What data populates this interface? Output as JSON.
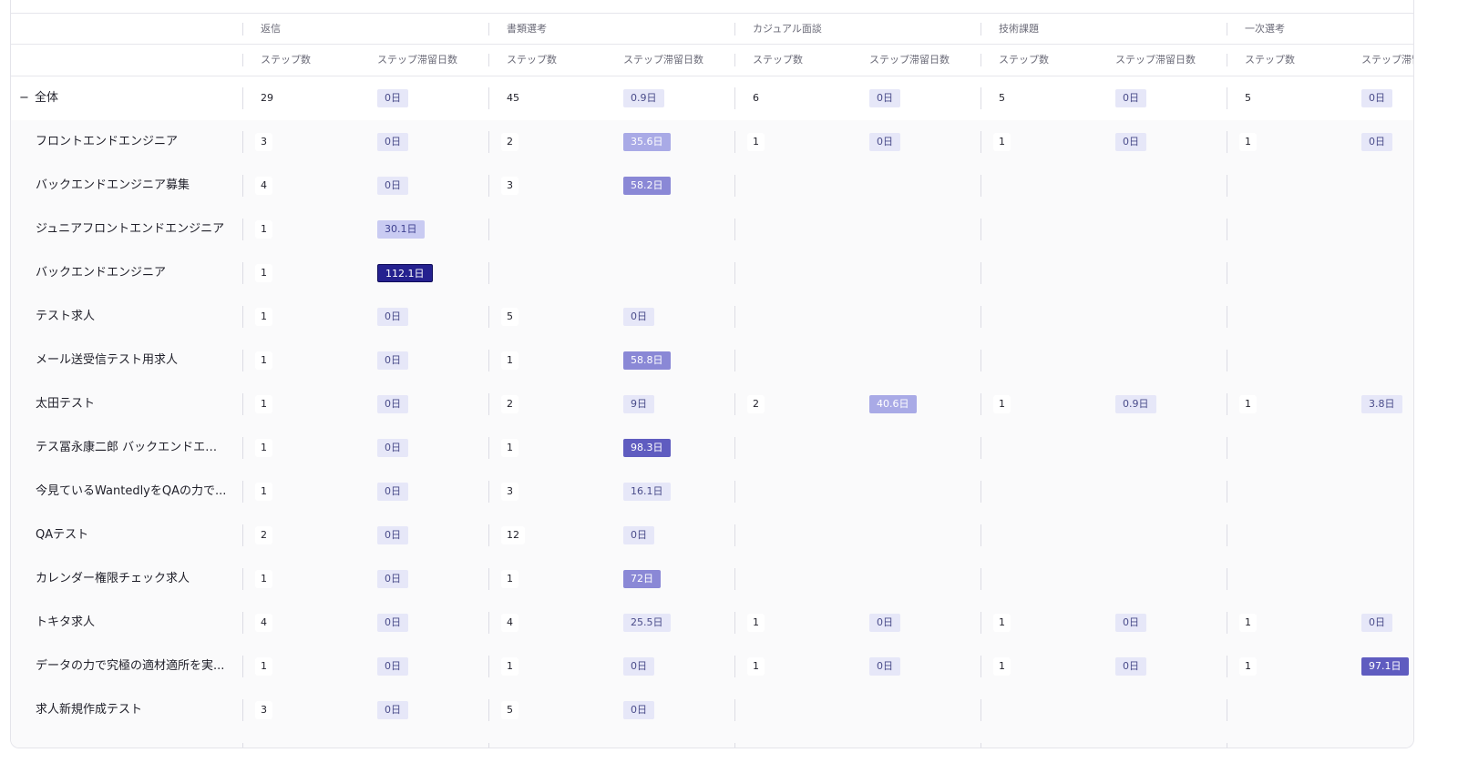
{
  "header": {
    "groups": [
      "返信",
      "書類選考",
      "カジュアル面談",
      "技術課題",
      "一次選考"
    ],
    "sub_step": "ステップ数",
    "sub_days": "ステップ滞留日数"
  },
  "rows": [
    {
      "name": "全体",
      "toggle": "−",
      "cells": [
        [
          "29",
          "0日",
          "d0"
        ],
        [
          "45",
          "0.9日",
          "d0"
        ],
        [
          "6",
          "0日",
          "d0"
        ],
        [
          "5",
          "0日",
          "d0"
        ],
        [
          "5",
          "0日",
          "d0"
        ]
      ]
    },
    {
      "name": "フロントエンドエンジニア",
      "cells": [
        [
          "3",
          "0日",
          "d0"
        ],
        [
          "2",
          "35.6日",
          "d2"
        ],
        [
          "1",
          "0日",
          "d0"
        ],
        [
          "1",
          "0日",
          "d0"
        ],
        [
          "1",
          "0日",
          "d0"
        ]
      ]
    },
    {
      "name": "バックエンドエンジニア募集",
      "cells": [
        [
          "4",
          "0日",
          "d0"
        ],
        [
          "3",
          "58.2日",
          "d3"
        ],
        null,
        null,
        null
      ]
    },
    {
      "name": "ジュニアフロントエンドエンジニア",
      "cells": [
        [
          "1",
          "30.1日",
          "d1"
        ],
        null,
        null,
        null,
        null
      ]
    },
    {
      "name": "バックエンドエンジニア",
      "cells": [
        [
          "1",
          "112.1日",
          "d5"
        ],
        null,
        null,
        null,
        null
      ]
    },
    {
      "name": "テスト求人",
      "cells": [
        [
          "1",
          "0日",
          "d0"
        ],
        [
          "5",
          "0日",
          "d0"
        ],
        null,
        null,
        null
      ]
    },
    {
      "name": "メール送受信テスト用求人",
      "cells": [
        [
          "1",
          "0日",
          "d0"
        ],
        [
          "1",
          "58.8日",
          "d3"
        ],
        null,
        null,
        null
      ]
    },
    {
      "name": "太田テスト",
      "cells": [
        [
          "1",
          "0日",
          "d0"
        ],
        [
          "2",
          "9日",
          "d0"
        ],
        [
          "2",
          "40.6日",
          "d2"
        ],
        [
          "1",
          "0.9日",
          "d0"
        ],
        [
          "1",
          "3.8日",
          "d0"
        ]
      ]
    },
    {
      "name": "テス冨永康二郎 バックエンドエン...",
      "cells": [
        [
          "1",
          "0日",
          "d0"
        ],
        [
          "1",
          "98.3日",
          "d4"
        ],
        null,
        null,
        null
      ]
    },
    {
      "name": "今見ているWantedlyをQAの力で...",
      "cells": [
        [
          "1",
          "0日",
          "d0"
        ],
        [
          "3",
          "16.1日",
          "d0"
        ],
        null,
        null,
        null
      ]
    },
    {
      "name": "QAテスト",
      "cells": [
        [
          "2",
          "0日",
          "d0"
        ],
        [
          "12",
          "0日",
          "d0"
        ],
        null,
        null,
        null
      ]
    },
    {
      "name": "カレンダー権限チェック求人",
      "cells": [
        [
          "1",
          "0日",
          "d0"
        ],
        [
          "1",
          "72日",
          "d3"
        ],
        null,
        null,
        null
      ]
    },
    {
      "name": "トキタ求人",
      "cells": [
        [
          "4",
          "0日",
          "d0"
        ],
        [
          "4",
          "25.5日",
          "d0"
        ],
        [
          "1",
          "0日",
          "d0"
        ],
        [
          "1",
          "0日",
          "d0"
        ],
        [
          "1",
          "0日",
          "d0"
        ]
      ]
    },
    {
      "name": "データの力で究極の適材適所を実...",
      "cells": [
        [
          "1",
          "0日",
          "d0"
        ],
        [
          "1",
          "0日",
          "d0"
        ],
        [
          "1",
          "0日",
          "d0"
        ],
        [
          "1",
          "0日",
          "d0"
        ],
        [
          "1",
          "97.1日",
          "d4"
        ]
      ]
    },
    {
      "name": "求人新規作成テスト",
      "cells": [
        [
          "3",
          "0日",
          "d0"
        ],
        [
          "5",
          "0日",
          "d0"
        ],
        null,
        null,
        null
      ]
    }
  ]
}
